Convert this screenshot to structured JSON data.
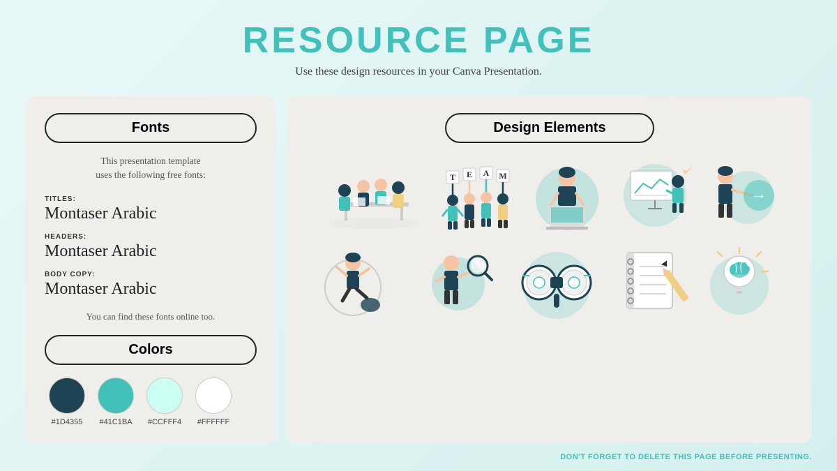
{
  "header": {
    "title": "RESOURCE PAGE",
    "subtitle": "Use these design resources in your Canva Presentation."
  },
  "fonts_panel": {
    "header_label": "Fonts",
    "description_line1": "This presentation template",
    "description_line2": "uses the following free fonts:",
    "entries": [
      {
        "label": "TITLES:",
        "name": "Montaser Arabic"
      },
      {
        "label": "HEADERS:",
        "name": "Montaser Arabic"
      },
      {
        "label": "BODY COPY:",
        "name": "Montaser Arabic"
      }
    ],
    "note": "You can find these fonts online too."
  },
  "colors_panel": {
    "header_label": "Colors",
    "swatches": [
      {
        "hex": "#1D4355",
        "label": "#1D4355"
      },
      {
        "hex": "#41C1BA",
        "label": "#41C1BA"
      },
      {
        "hex": "#CCFFF4",
        "label": "#CCFFF4"
      },
      {
        "hex": "#FFFFFF",
        "label": "#FFFFFF"
      }
    ]
  },
  "design_elements": {
    "header_label": "Design Elements"
  },
  "footer": {
    "note": "DON'T FORGET TO DELETE THIS PAGE BEFORE PRESENTING."
  }
}
